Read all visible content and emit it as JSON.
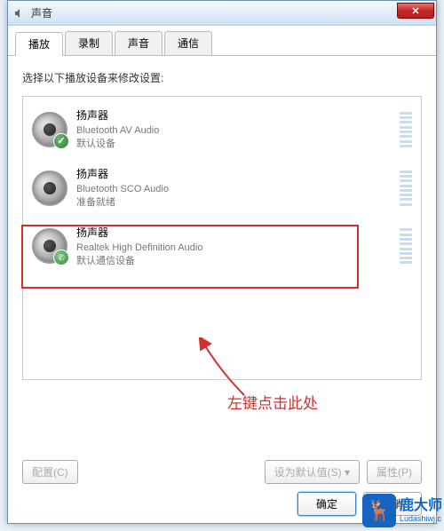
{
  "window": {
    "title": "声音"
  },
  "tabs": [
    {
      "label": "播放",
      "active": true
    },
    {
      "label": "录制",
      "active": false
    },
    {
      "label": "声音",
      "active": false
    },
    {
      "label": "通信",
      "active": false
    }
  ],
  "instruction": "选择以下播放设备来修改设置:",
  "devices": [
    {
      "title": "扬声器",
      "subtitle": "Bluetooth AV Audio",
      "status": "默认设备",
      "badge": "check",
      "selected": false
    },
    {
      "title": "扬声器",
      "subtitle": "Bluetooth SCO Audio",
      "status": "准备就绪",
      "badge": "none",
      "selected": false
    },
    {
      "title": "扬声器",
      "subtitle": "Realtek High Definition Audio",
      "status": "默认通信设备",
      "badge": "phone",
      "selected": true
    }
  ],
  "annotation": "左键点击此处",
  "buttons": {
    "configure": "配置(C)",
    "setdefault": "设为默认值(S) ▾",
    "properties": "属性(P)"
  },
  "dialog": {
    "ok": "确定",
    "cancel": "取消"
  },
  "watermark": {
    "brand": "鹿大师",
    "url": "Ludashiwj.c"
  }
}
